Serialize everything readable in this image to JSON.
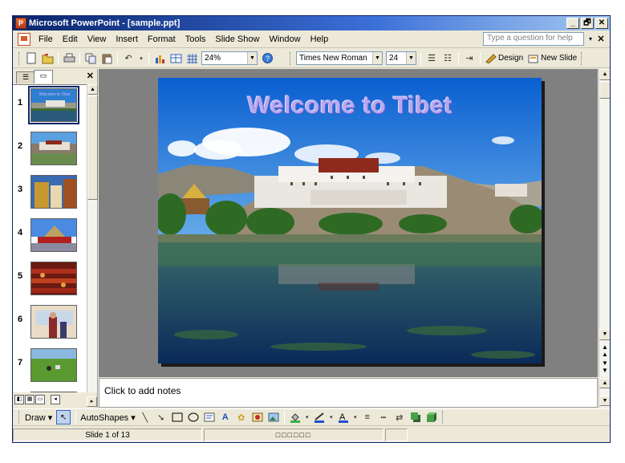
{
  "window": {
    "title": "Microsoft PowerPoint - [sample.ppt]",
    "controls": [
      "_",
      "🗗",
      "✕"
    ]
  },
  "menu": {
    "items": [
      "File",
      "Edit",
      "View",
      "Insert",
      "Format",
      "Tools",
      "Slide Show",
      "Window",
      "Help"
    ],
    "ask_placeholder": "Type a question for help",
    "ask_dropdown": "▾",
    "close": "✕"
  },
  "toolbar": {
    "zoom": "24%",
    "font": "Times New Roman",
    "font_size": "24",
    "design_label": "Design",
    "new_slide_label": "New Slide"
  },
  "thumbnails": {
    "numbers": [
      "1",
      "2",
      "3",
      "4",
      "5",
      "6",
      "7"
    ],
    "selected_index": 0
  },
  "pane": {
    "close": "✕"
  },
  "slide": {
    "title": "Welcome to Tibet"
  },
  "notes": {
    "placeholder": "Click to add notes"
  },
  "drawing": {
    "draw_label": "Draw",
    "autoshapes_label": "AutoShapes"
  },
  "status": {
    "slide_position": "Slide 1 of 13",
    "design_indicator": "□□□□□□"
  },
  "colors": {
    "title_bar_start": "#0a246a",
    "title_bar_end": "#a6caf0",
    "title_text": "#b8a9f0"
  }
}
